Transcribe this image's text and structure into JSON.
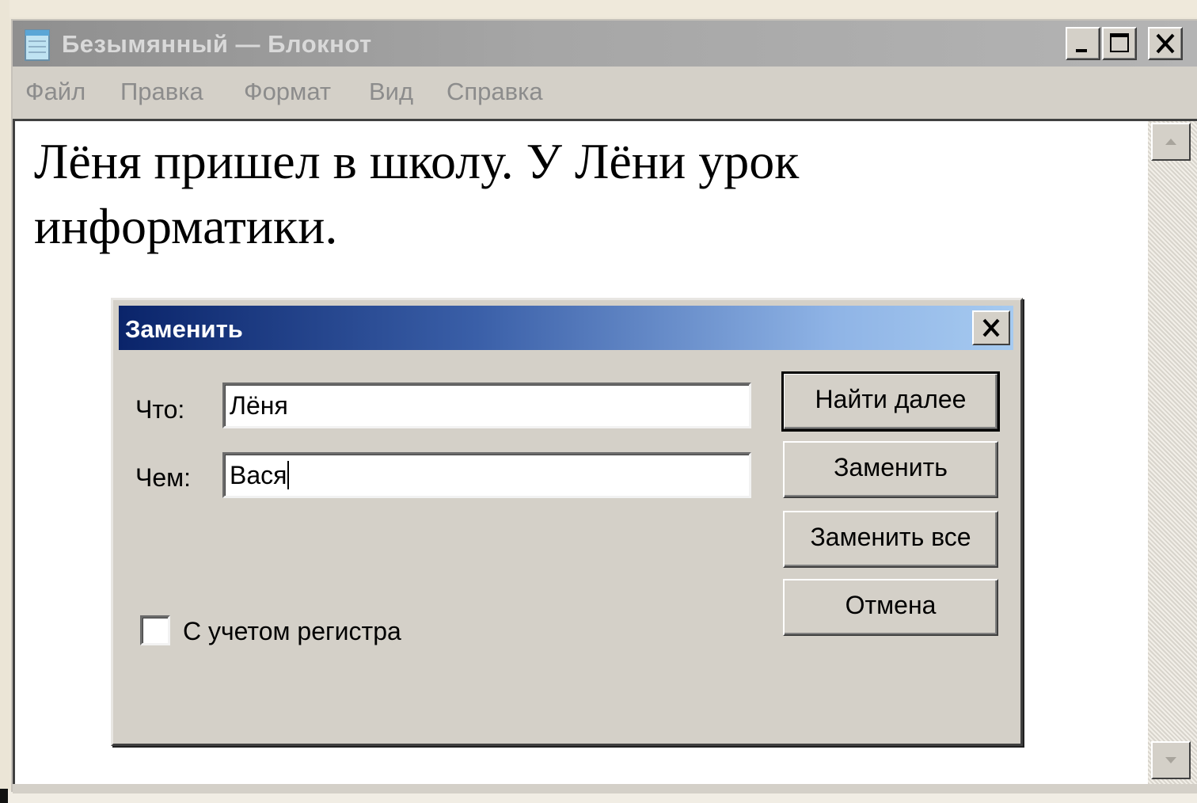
{
  "window": {
    "title": "Безымянный — Блокнот",
    "icon": "notepad-icon",
    "controls": {
      "minimize_icon": "minimize-icon",
      "maximize_icon": "maximize-icon",
      "close_icon": "close-icon"
    }
  },
  "menu": {
    "items": [
      "Файл",
      "Правка",
      "Формат",
      "Вид",
      "Справка"
    ]
  },
  "editor": {
    "text": "Лёня пришел в школу. У Лёни урок информатики."
  },
  "dialog": {
    "title": "Заменить",
    "find_label": "Что:",
    "find_value": "Лёня",
    "replace_label": "Чем:",
    "replace_value": "Вася",
    "match_case_label": "С учетом регистра",
    "match_case_checked": false,
    "buttons": {
      "find_next": "Найти далее",
      "replace": "Заменить",
      "replace_all": "Заменить все",
      "cancel": "Отмена"
    }
  },
  "colors": {
    "dialog_title_gradient_start": "#0a246a",
    "dialog_title_gradient_end": "#a6caf0",
    "face": "#d4d0c8"
  }
}
